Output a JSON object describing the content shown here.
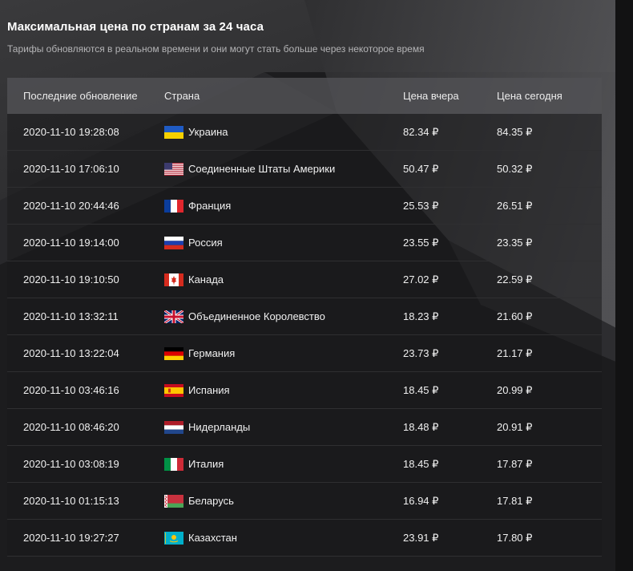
{
  "header": {
    "title": "Максимальная цена по странам за 24 часа",
    "subtitle": "Тарифы обновляются в реальном времени и они могут стать больше через некоторое время"
  },
  "table": {
    "columns": [
      "Последние обновление",
      "Страна",
      "Цена вчера",
      "Цена сегодня"
    ],
    "rows": [
      {
        "updated": "2020-11-10 19:28:08",
        "flag": "ua-flag-icon",
        "country": "Украина",
        "yesterday": "82.34 ₽",
        "today": "84.35 ₽"
      },
      {
        "updated": "2020-11-10 17:06:10",
        "flag": "us-flag-icon",
        "country": "Соединенные Штаты Америки",
        "yesterday": "50.47 ₽",
        "today": "50.32 ₽"
      },
      {
        "updated": "2020-11-10 20:44:46",
        "flag": "fr-flag-icon",
        "country": "Франция",
        "yesterday": "25.53 ₽",
        "today": "26.51 ₽"
      },
      {
        "updated": "2020-11-10 19:14:00",
        "flag": "ru-flag-icon",
        "country": "Россия",
        "yesterday": "23.55 ₽",
        "today": "23.35 ₽"
      },
      {
        "updated": "2020-11-10 19:10:50",
        "flag": "ca-flag-icon",
        "country": "Канада",
        "yesterday": "27.02 ₽",
        "today": "22.59 ₽"
      },
      {
        "updated": "2020-11-10 13:32:11",
        "flag": "gb-flag-icon",
        "country": "Объединенное Королевство",
        "yesterday": "18.23 ₽",
        "today": "21.60 ₽"
      },
      {
        "updated": "2020-11-10 13:22:04",
        "flag": "de-flag-icon",
        "country": "Германия",
        "yesterday": "23.73 ₽",
        "today": "21.17 ₽"
      },
      {
        "updated": "2020-11-10 03:46:16",
        "flag": "es-flag-icon",
        "country": "Испания",
        "yesterday": "18.45 ₽",
        "today": "20.99 ₽"
      },
      {
        "updated": "2020-11-10 08:46:20",
        "flag": "nl-flag-icon",
        "country": "Нидерланды",
        "yesterday": "18.48 ₽",
        "today": "20.91 ₽"
      },
      {
        "updated": "2020-11-10 03:08:19",
        "flag": "it-flag-icon",
        "country": "Италия",
        "yesterday": "18.45 ₽",
        "today": "17.87 ₽"
      },
      {
        "updated": "2020-11-10 01:15:13",
        "flag": "by-flag-icon",
        "country": "Беларусь",
        "yesterday": "16.94 ₽",
        "today": "17.81 ₽"
      },
      {
        "updated": "2020-11-10 19:27:27",
        "flag": "kz-flag-icon",
        "country": "Казахстан",
        "yesterday": "23.91 ₽",
        "today": "17.80 ₽"
      }
    ]
  }
}
